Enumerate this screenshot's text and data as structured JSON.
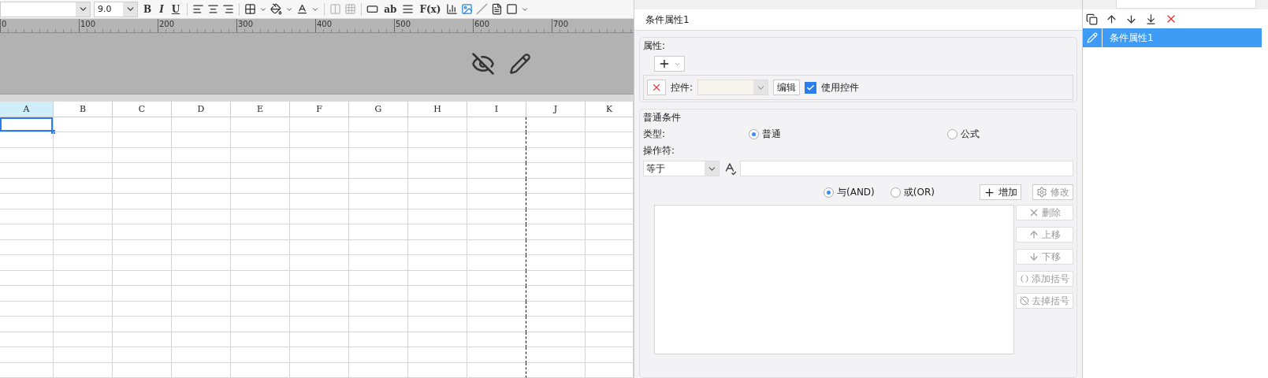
{
  "toolbar": {
    "font_size": "9.0",
    "bold": "B",
    "italic": "I",
    "underline": "U",
    "wrap_label": "ab",
    "formula_label": "F(x)"
  },
  "ruler": {
    "labels": [
      "0",
      "100",
      "200",
      "300",
      "400",
      "500",
      "600",
      "700"
    ]
  },
  "sheet": {
    "columns": [
      {
        "label": "A",
        "selected": true
      },
      {
        "label": "B",
        "selected": false
      },
      {
        "label": "C",
        "selected": false
      },
      {
        "label": "D",
        "selected": false
      },
      {
        "label": "E",
        "selected": false
      },
      {
        "label": "F",
        "selected": false
      },
      {
        "label": "G",
        "selected": false
      },
      {
        "label": "H",
        "selected": false
      },
      {
        "label": "I",
        "selected": false
      },
      {
        "label": "J",
        "selected": false
      },
      {
        "label": "K",
        "selected": false
      }
    ]
  },
  "dialog": {
    "title": "条件属性1",
    "attr_legend": "属性:",
    "control_label": "控件:",
    "control_combo": {
      "disabled": true
    },
    "edit_button": "编辑",
    "use_control": {
      "label": "使用控件",
      "checked": true
    },
    "condition_legend": "普通条件",
    "type_label": "类型:",
    "type_options": [
      {
        "label": "普通",
        "selected": true
      },
      {
        "label": "公式",
        "selected": false
      }
    ],
    "operator_label": "操作符:",
    "operator": "等于",
    "logic_options": [
      {
        "label": "与(AND)",
        "selected": true
      },
      {
        "label": "或(OR)",
        "selected": false
      }
    ],
    "add_button": {
      "label": "增加",
      "disabled": false
    },
    "modify_button": {
      "label": "修改",
      "disabled": true
    },
    "side_buttons": [
      {
        "kind": "delete",
        "label": "删除",
        "disabled": true
      },
      {
        "kind": "up",
        "label": "上移",
        "disabled": true
      },
      {
        "kind": "down",
        "label": "下移",
        "disabled": true
      },
      {
        "kind": "add_brackets",
        "label": "添加括号",
        "disabled": true
      },
      {
        "kind": "remove_brackets",
        "label": "去掉括号",
        "disabled": true
      }
    ]
  },
  "condition_list": {
    "items": [
      {
        "label": "条件属性1",
        "selected": true
      }
    ]
  }
}
